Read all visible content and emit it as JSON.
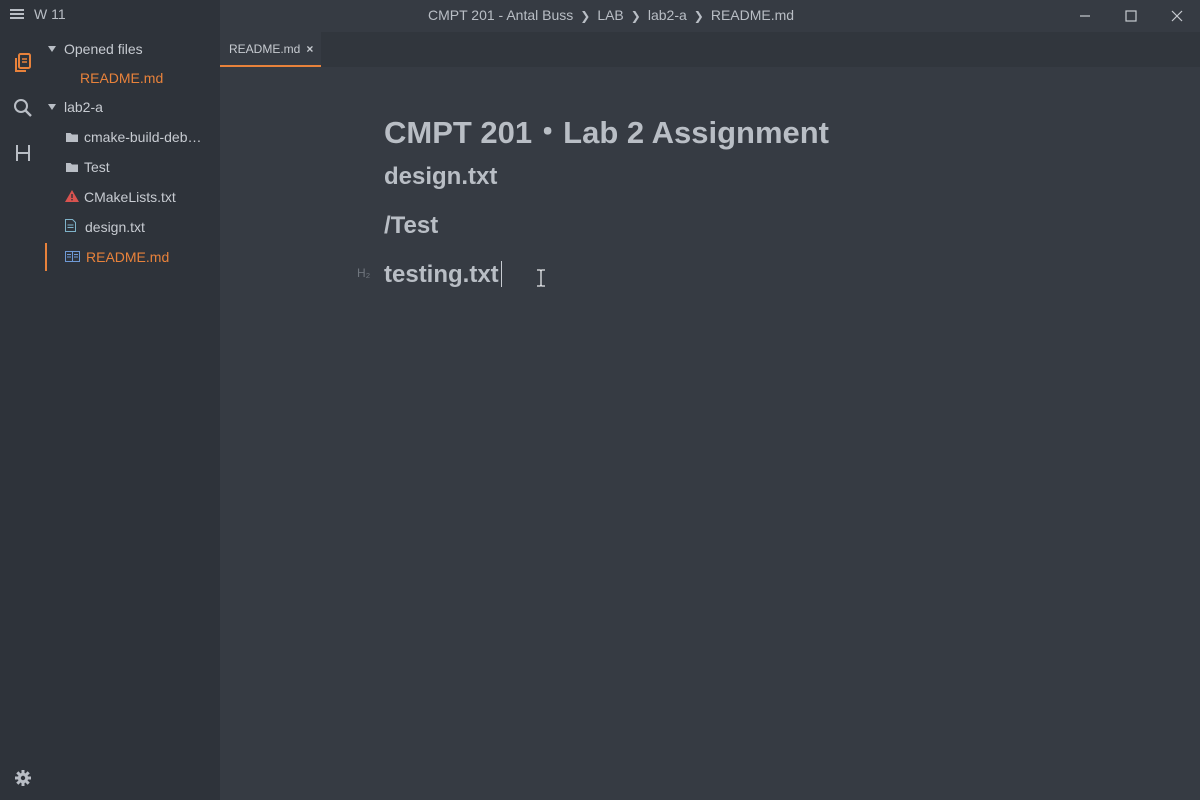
{
  "app": {
    "title": "W 11"
  },
  "window": {
    "breadcrumb": [
      "CMPT 201 - Antal Buss",
      "LAB",
      "lab2-a",
      "README.md"
    ]
  },
  "tabs": [
    {
      "label": "README.md",
      "close": "×"
    }
  ],
  "sidebar": {
    "opened_files_label": "Opened files",
    "opened_files": [
      "README.md"
    ],
    "project_label": "lab2-a",
    "items": [
      {
        "label": "cmake-build-deb…",
        "icon": "folder-icon"
      },
      {
        "label": "Test",
        "icon": "folder-icon"
      },
      {
        "label": "CMakeLists.txt",
        "icon": "warning-icon"
      },
      {
        "label": "design.txt",
        "icon": "text-file-icon"
      },
      {
        "label": "README.md",
        "icon": "markdown-icon"
      }
    ]
  },
  "editor": {
    "lines": [
      {
        "level": "h1",
        "text": "CMPT 201・Lab 2 Assignment"
      },
      {
        "level": "h2",
        "text": "design.txt"
      },
      {
        "level": "h2",
        "text": "/Test"
      },
      {
        "level": "h2",
        "text": "testing.txt"
      }
    ],
    "heading_badge": "H₂"
  },
  "colors": {
    "accent": "#e8823b",
    "background": "#363b43",
    "sidebar": "#2e333a",
    "warning": "#d9534f"
  }
}
